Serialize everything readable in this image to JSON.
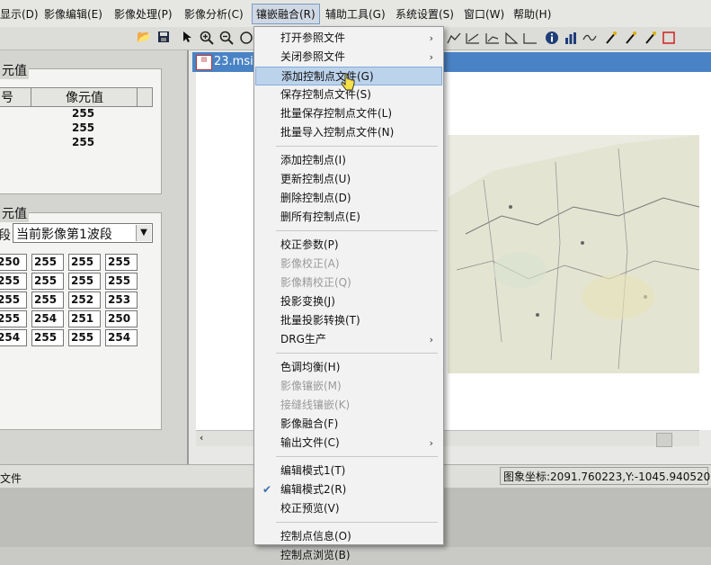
{
  "menubar": {
    "items": [
      "显示(D)",
      "影像编辑(E)",
      "影像处理(P)",
      "影像分析(C)",
      "镶嵌融合(R)",
      "辅助工具(G)",
      "系统设置(S)",
      "窗口(W)",
      "帮助(H)"
    ],
    "active_index": 4
  },
  "left_panel": {
    "group1_title": "元值",
    "table1": {
      "col1_header": "号",
      "col2_header": "像元值",
      "values": [
        "255",
        "255",
        "255"
      ]
    },
    "group2_title": "元值",
    "band_label": "段",
    "band_select": "当前影像第1波段",
    "grid": [
      [
        "250",
        "255",
        "255",
        "255"
      ],
      [
        "255",
        "255",
        "255",
        "255"
      ],
      [
        "255",
        "255",
        "252",
        "253"
      ],
      [
        "255",
        "254",
        "251",
        "250"
      ],
      [
        "254",
        "255",
        "255",
        "254"
      ]
    ]
  },
  "image_window": {
    "tab_title": "23.msi"
  },
  "statusbar": {
    "left_text": "文件",
    "coords": "图象坐标:2091.760223,Y:-1045.940520"
  },
  "dropdown": {
    "items": [
      {
        "label": "打开参照文件",
        "submenu": true
      },
      {
        "label": "关闭参照文件",
        "submenu": true
      },
      {
        "label": "添加控制点文件(G)",
        "highlighted": true
      },
      {
        "label": "保存控制点文件(S)"
      },
      {
        "label": "批量保存控制点文件(L)"
      },
      {
        "label": "批量导入控制点文件(N)"
      },
      {
        "label": "添加控制点(I)"
      },
      {
        "label": "更新控制点(U)"
      },
      {
        "label": "删除控制点(D)"
      },
      {
        "label": "删所有控制点(E)"
      },
      {
        "label": "校正参数(P)"
      },
      {
        "label": "影像校正(A)",
        "disabled": true
      },
      {
        "label": "影像精校正(Q)",
        "disabled": true
      },
      {
        "label": "投影变换(J)"
      },
      {
        "label": "批量投影转换(T)"
      },
      {
        "label": "DRG生产",
        "submenu": true
      },
      {
        "label": "色调均衡(H)"
      },
      {
        "label": "影像镶嵌(M)",
        "disabled": true
      },
      {
        "label": "接缝线镶嵌(K)",
        "disabled": true
      },
      {
        "label": "影像融合(F)"
      },
      {
        "label": "输出文件(C)",
        "submenu": true
      },
      {
        "label": "编辑模式1(T)"
      },
      {
        "label": "编辑模式2(R)",
        "checked": true
      },
      {
        "label": "校正预览(V)"
      },
      {
        "label": "控制点信息(O)"
      },
      {
        "label": "控制点浏览(B)"
      }
    ],
    "arrow_glyph": "›",
    "check_glyph": "✔"
  },
  "colors": {
    "titlebar": "#4a83c5",
    "menu_highlight": "#bcd3ec"
  }
}
